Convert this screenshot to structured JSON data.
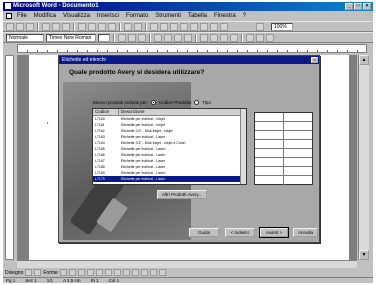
{
  "window": {
    "title": "Microsoft Word - Documento1"
  },
  "menu": [
    "File",
    "Modifica",
    "Visualizza",
    "Inserisci",
    "Formato",
    "Strumenti",
    "Tabella",
    "Finestra",
    "?"
  ],
  "format_bar": {
    "style": "Normale",
    "font": "Times New Roman",
    "zoom": "100%"
  },
  "dialog": {
    "title": "Etichette ed elenchi",
    "question": "Quale prodotto Avery si desidera utilizzare?",
    "brand_label": "Elenco prodotti ordinati per:",
    "brand_options": [
      "Codice Prodotto",
      "Tipo"
    ],
    "list_headers": [
      "Codice",
      "Descrizione"
    ],
    "list_items": [
      {
        "code": "L7160",
        "desc": "Etichette per indirizzi - Inkjet"
      },
      {
        "code": "L7161",
        "desc": "Etichette per indirizzi - Inkjet"
      },
      {
        "code": "L7162",
        "desc": "Etichette 3.5\" - Disk Inkjet - Inkjet"
      },
      {
        "code": "L7163",
        "desc": "Etichette per indirizzi - Laser"
      },
      {
        "code": "L7164",
        "desc": "Etichette 3.5\" - Disk Inkjet - Inkjet a Colori"
      },
      {
        "code": "L7165",
        "desc": "Etichette per indirizzi - Laser"
      },
      {
        "code": "L7166",
        "desc": "Etichette per indirizzi - Laser"
      },
      {
        "code": "L7167",
        "desc": "Etichette per indirizzi - Laser"
      },
      {
        "code": "L7168",
        "desc": "Etichette per indirizzi - Laser"
      },
      {
        "code": "L7169",
        "desc": "Etichette per indirizzi - Laser"
      },
      {
        "code": "L7170",
        "desc": "Etichette per indirizzi - Laser"
      }
    ],
    "selected_index": 10,
    "details_button": "Altri Prodotti Avery...",
    "buttons": {
      "help": "Guida",
      "cancel": "< Indietro",
      "ok": "Avanti >",
      "close": "Annulla"
    }
  },
  "drawing_bar": {
    "draw": "Disegno",
    "shapes": "Forme"
  },
  "status": [
    "Pg 1",
    "Sez 1",
    "1/1",
    "A 2,5 cm",
    "Ri 1",
    "Col 1"
  ],
  "accent": "#0a1a8a"
}
